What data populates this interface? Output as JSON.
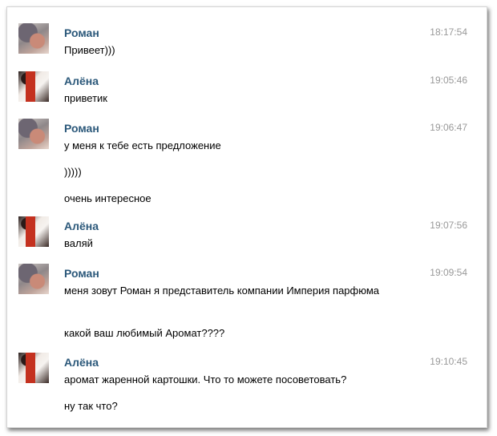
{
  "messages": [
    {
      "sender": "Роман",
      "time": "18:17:54",
      "lines": [
        "Привеет)))"
      ]
    },
    {
      "sender": "Алёна",
      "time": "19:05:46",
      "lines": [
        "приветик"
      ]
    },
    {
      "sender": "Роман",
      "time": "19:06:47",
      "lines": [
        "у меня к тебе есть предложение",
        ")))))",
        "очень интересное"
      ]
    },
    {
      "sender": "Алёна",
      "time": "19:07:56",
      "lines": [
        "валяй"
      ]
    },
    {
      "sender": "Роман",
      "time": "19:09:54",
      "lines": [
        "меня зовут Роман я представитель компании Империя парфюма",
        "какой ваш любимый Аромат????"
      ]
    },
    {
      "sender": "Алёна",
      "time": "19:10:45",
      "lines": [
        "аромат жаренной картошки. Что то можете посоветовать?",
        "ну так что?"
      ]
    }
  ],
  "colors": {
    "name": "#2b587a",
    "time": "#999999",
    "text": "#000000"
  }
}
